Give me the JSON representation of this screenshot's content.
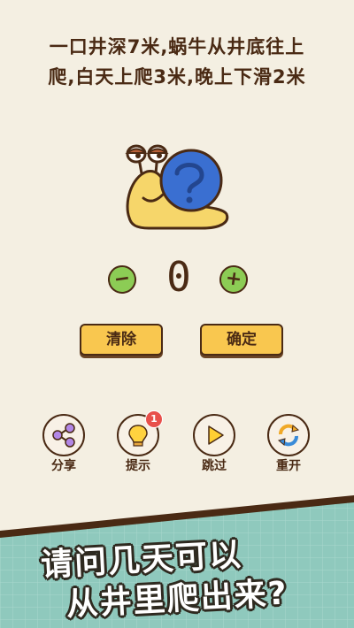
{
  "question": {
    "line1": "一口井深7米,蜗牛从井底往上",
    "line2": "爬,白天上爬3米,晚上下滑2米"
  },
  "counter": {
    "minus_label": "−",
    "value": "0",
    "plus_label": "+"
  },
  "actions": {
    "clear_label": "清除",
    "confirm_label": "确定"
  },
  "tools": [
    {
      "label": "分享",
      "icon": "share-icon"
    },
    {
      "label": "提示",
      "icon": "lightbulb-icon",
      "badge": "1"
    },
    {
      "label": "跳过",
      "icon": "play-icon"
    },
    {
      "label": "重开",
      "icon": "restart-icon"
    }
  ],
  "promo": {
    "line1": "请问几天可以",
    "line2": "从井里爬出来?"
  },
  "colors": {
    "background": "#f4efe2",
    "accent_yellow": "#f9c74f",
    "accent_green": "#8ccc55",
    "snail_shell": "#3a6fd1",
    "snail_body": "#f6d66a",
    "bottom_band": "#8fc9bd"
  }
}
